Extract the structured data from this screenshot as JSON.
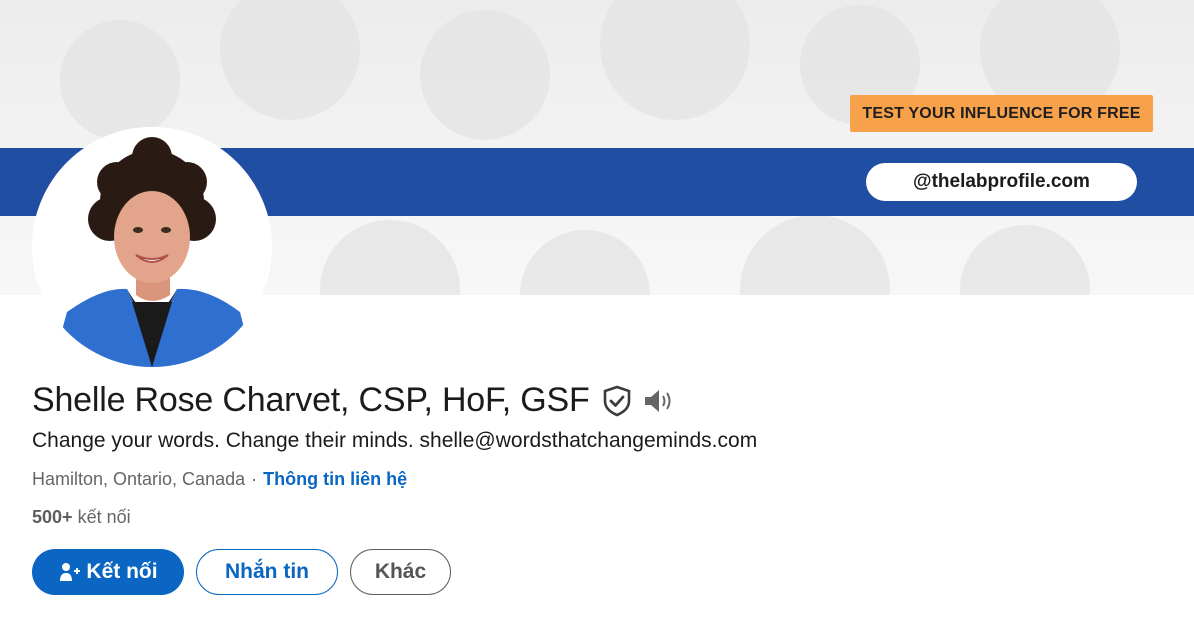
{
  "banner": {
    "cta_label": "TEST YOUR INFLUENCE FOR FREE",
    "handle": "@thelabprofile.com",
    "colors": {
      "stripe": "#1f4ea3",
      "cta": "#f7a24b"
    }
  },
  "profile": {
    "name": "Shelle Rose Charvet, CSP, HoF, GSF",
    "headline": "Change your words. Change their minds. shelle@wordsthatchangeminds.com",
    "location": "Hamilton, Ontario, Canada",
    "separator": "·",
    "contact_link": "Thông tin liên hệ",
    "connections_count": "500+",
    "connections_label": "kết nối"
  },
  "actions": {
    "connect_label": "Kết nối",
    "message_label": "Nhắn tin",
    "more_label": "Khác"
  },
  "icons": [
    "verified-shield-icon",
    "speaker-icon",
    "add-person-icon"
  ],
  "colors": {
    "accent": "#0a66c2"
  }
}
